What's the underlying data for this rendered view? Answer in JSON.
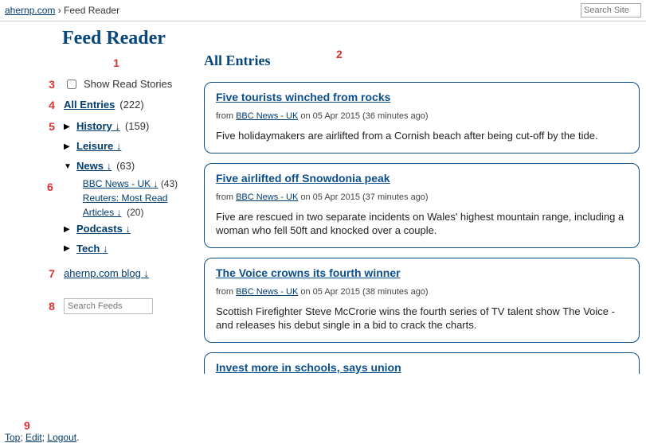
{
  "breadcrumb": {
    "site": "ahernp.com",
    "sep": " › ",
    "page": "Feed Reader"
  },
  "search_site_placeholder": "Search Site",
  "page_title": "Feed Reader",
  "annotations": {
    "n1": "1",
    "n2": "2",
    "n3": "3",
    "n4": "4",
    "n5": "5",
    "n6": "6",
    "n7": "7",
    "n8": "8",
    "n9": "9"
  },
  "sidebar": {
    "show_read": "Show Read Stories",
    "all_entries": {
      "label": "All Entries",
      "count": "(222)"
    },
    "history": {
      "label": "History",
      "arrow": "↓",
      "count": "(159)"
    },
    "leisure": {
      "label": "Leisure",
      "arrow": "↓"
    },
    "news": {
      "label": "News",
      "arrow": "↓",
      "count": "(63)"
    },
    "bbc": {
      "label": "BBC News - UK",
      "arrow": "↓",
      "count": "(43)"
    },
    "reuters": {
      "label": "Reuters: Most Read Articles",
      "arrow": "↓",
      "count": "(20)"
    },
    "podcasts": {
      "label": "Podcasts",
      "arrow": "↓"
    },
    "tech": {
      "label": "Tech",
      "arrow": "↓"
    },
    "blog": {
      "label": "ahernp.com blog",
      "arrow": "↓"
    },
    "search_placeholder": "Search Feeds"
  },
  "main_heading": "All Entries",
  "entries": [
    {
      "title": "Five tourists winched from rocks",
      "from": "from ",
      "src": "BBC News - UK",
      "date": " on 05 Apr 2015 (36 minutes ago)",
      "body": "Five holidaymakers are airlifted from a Cornish beach after being cut-off by the tide."
    },
    {
      "title": "Five airlifted off Snowdonia peak",
      "from": "from ",
      "src": "BBC News - UK",
      "date": " on 05 Apr 2015 (37 minutes ago)",
      "body": "Five are rescued in two separate incidents on Wales' highest mountain range, including a woman who fell 50ft and knocked over a couple."
    },
    {
      "title": "The Voice crowns its fourth winner",
      "from": "from ",
      "src": "BBC News - UK",
      "date": " on 05 Apr 2015 (38 minutes ago)",
      "body": "Scottish Firefighter Steve McCrorie wins the fourth series of TV talent show The Voice - and releases his debut single in a bid to crack the charts."
    },
    {
      "title": "Invest more in schools, says union"
    }
  ],
  "footer": {
    "top": "Top",
    "edit": "Edit",
    "logout": "Logout",
    "sep1": "; ",
    "sep2": "; ",
    "end": "."
  }
}
